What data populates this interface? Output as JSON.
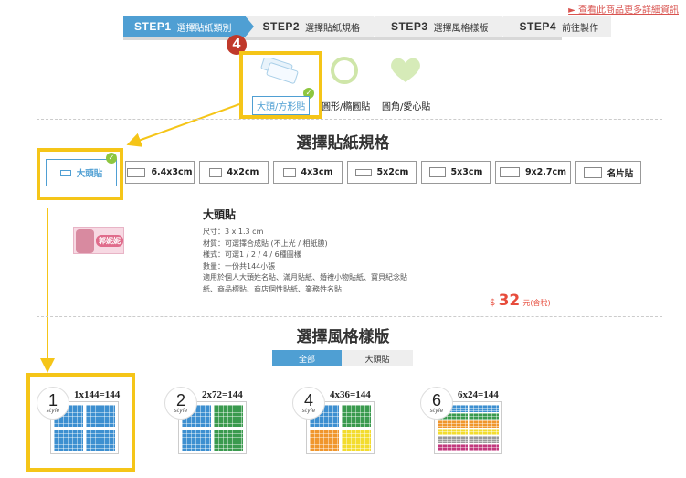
{
  "top_link": "► 查看此商品更多詳細資訊",
  "steps": [
    {
      "num": "STEP1",
      "label": "選擇貼紙類別"
    },
    {
      "num": "STEP2",
      "label": "選擇貼紙規格"
    },
    {
      "num": "STEP3",
      "label": "選擇風格樣版"
    },
    {
      "num": "STEP4",
      "label": "前往製作"
    }
  ],
  "badge": "4",
  "shapes": [
    {
      "label": "大頭/方形貼",
      "selected": true
    },
    {
      "label": "圓形/橢圓貼",
      "selected": false
    },
    {
      "label": "圓角/愛心貼",
      "selected": false
    }
  ],
  "section_size_title": "選擇貼紙規格",
  "sizes": [
    "大頭貼",
    "6.4x3cm",
    "4x2cm",
    "4x3cm",
    "5x2cm",
    "5x3cm",
    "9x2.7cm",
    "名片貼"
  ],
  "product": {
    "title": "大頭貼",
    "thumb_text": "郭妮妮",
    "lines": [
      "尺寸：3 x 1.3 cm",
      "材質：可選擇合成貼 (不上光 / 相紙膜)",
      "樣式：可選1 / 2 / 4 / 6種圖樣",
      "數量：一份共144小張",
      "適用於個人大頭姓名貼、滿月貼紙、婚禮小物貼紙、寶貝紀念貼",
      "紙、商品標貼、商店個性貼紙、業務姓名貼"
    ],
    "price_symbol": "$",
    "price_value": "32",
    "price_tax": "元(含稅)"
  },
  "section_style_title": "選擇風格樣版",
  "tabs": [
    "全部",
    "大頭貼"
  ],
  "styles": [
    {
      "num": "1",
      "style_word": "style",
      "caption": "1x144=144"
    },
    {
      "num": "2",
      "style_word": "style",
      "caption": "2x72=144"
    },
    {
      "num": "4",
      "style_word": "style",
      "caption": "4x36=144"
    },
    {
      "num": "6",
      "style_word": "style",
      "caption": "6x24=144"
    }
  ],
  "colors": {
    "accent": "#4f9fd3",
    "highlight": "#f5c518",
    "badge": "#c0392b",
    "price": "#e74c3c",
    "check": "#8dc63f"
  }
}
